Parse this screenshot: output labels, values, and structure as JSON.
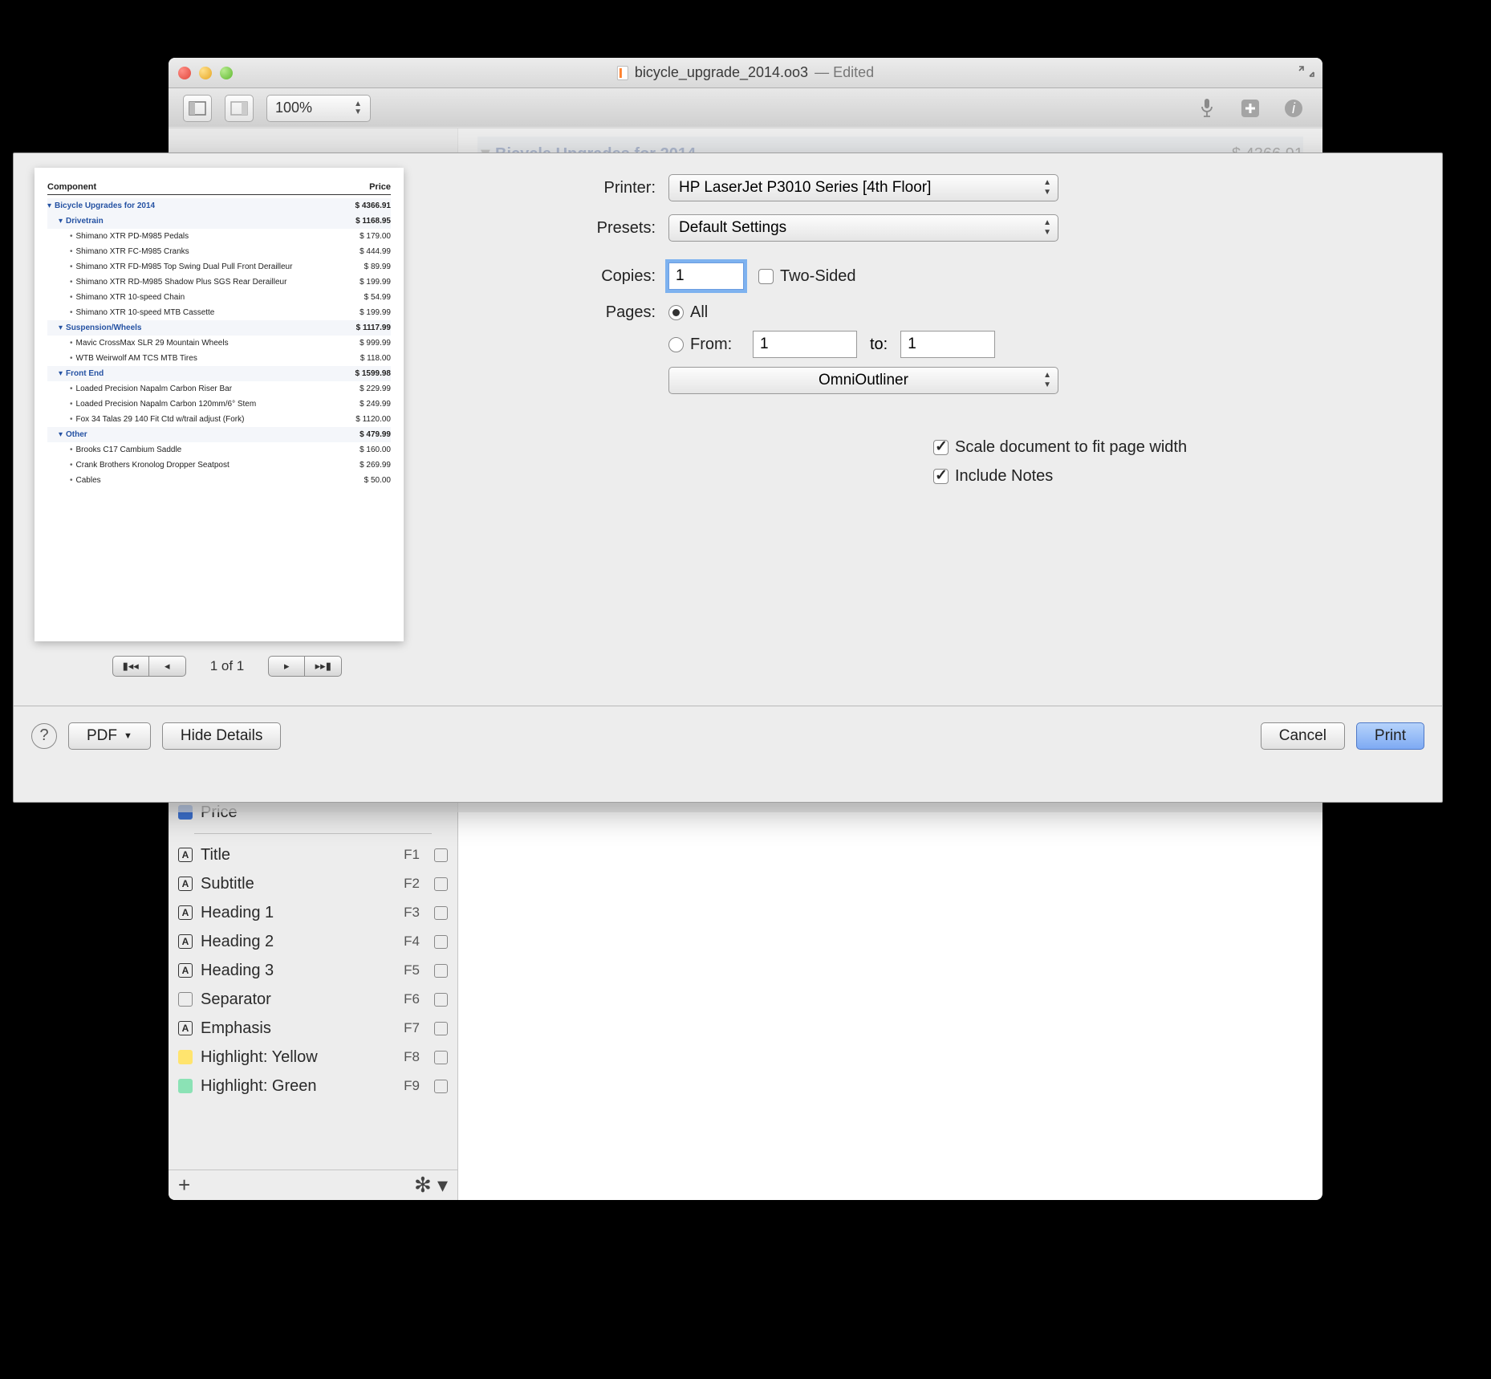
{
  "window": {
    "title": "bicycle_upgrade_2014.oo3",
    "status": "— Edited"
  },
  "toolbar": {
    "zoom": "100%"
  },
  "main": {
    "col1": "Component",
    "col2": "Price",
    "rows": [
      {
        "lbl": "Bicycle Upgrades for 2014",
        "price": "$ 4366.91",
        "lvl": 0,
        "tri": true,
        "hi": true
      },
      {
        "lbl": "Drivetrain",
        "price": "$ 1168.95",
        "lvl": 1,
        "tri": true,
        "hi": true
      },
      {
        "lbl": "Shimano XTR PD-M985 Pedals",
        "price": "$ 179.00",
        "lvl": 2
      },
      {
        "lbl": "Shimano XTR FC-M985 Cranks",
        "price": "$ 444.99",
        "lvl": 2
      },
      {
        "lbl": "Shimano XTR FD-M985 Top Swing Dual Pull Front Derailleur",
        "price": "$ 89.99",
        "lvl": 2
      },
      {
        "lbl": "Shimano XTR RD-M985 Shadow Plus SGS Rear Derailleur",
        "price": "$ 199.99",
        "lvl": 2
      },
      {
        "lbl": "Shimano XTR 10-speed Chain",
        "price": "$ 54.99",
        "lvl": 2
      },
      {
        "lbl": "Shimano XTR 10-speed MTB Cassette",
        "price": "$ 199.99",
        "lvl": 2
      },
      {
        "lbl": "Suspension/Wheels",
        "price": "$ 1117.99",
        "lvl": 1,
        "tri": true,
        "hi": true
      },
      {
        "lbl": "Mavic CrossMax SLR 29 Mountain Wheels",
        "price": "$ 999.99",
        "lvl": 2
      },
      {
        "lbl": "WTB Weirwolf AM TCS MTB Tires",
        "price": "$ 118.00",
        "lvl": 2
      },
      {
        "lbl": "Front End",
        "price": "$ 1599.98",
        "lvl": 1,
        "tri": true,
        "hi": true
      },
      {
        "lbl": "Loaded Precision Napalm Carbon Riser Bar",
        "price": "$ 229.99",
        "lvl": 2
      },
      {
        "lbl": "Loaded Precision Napalm Carbon 120mm/6° Stem",
        "price": "$ 249.99",
        "lvl": 2
      },
      {
        "lbl": "Fox 34 Talas 29 140 Fit Ctd w/trail adjust (Fork)",
        "price": "$ 1120.00",
        "lvl": 2
      },
      {
        "lbl": "Other",
        "price": "$ 479.99",
        "lvl": 1,
        "tri": true,
        "hi": true
      },
      {
        "lbl": "Brooks C17 Cambium Saddle",
        "price": "$ 160.00",
        "lvl": 2
      },
      {
        "lbl": "Crank Brothers Kronolog Dropper Seatpost",
        "price": "$ 269.99",
        "lvl": 2
      },
      {
        "lbl": "Cables",
        "price": "$ 50.00",
        "lvl": 2
      }
    ]
  },
  "sidebar": {
    "columns": [
      {
        "name": "Component"
      },
      {
        "name": "Price"
      }
    ],
    "styles": [
      {
        "name": "Title",
        "key": "F1"
      },
      {
        "name": "Subtitle",
        "key": "F2"
      },
      {
        "name": "Heading 1",
        "key": "F3"
      },
      {
        "name": "Heading 2",
        "key": "F4"
      },
      {
        "name": "Heading 3",
        "key": "F5"
      },
      {
        "name": "Separator",
        "key": "F6"
      },
      {
        "name": "Emphasis",
        "key": "F7"
      },
      {
        "name": "Highlight: Yellow",
        "key": "F8"
      },
      {
        "name": "Highlight: Green",
        "key": "F9"
      }
    ]
  },
  "print": {
    "printer_label": "Printer:",
    "printer_value": "HP LaserJet P3010 Series [4th Floor]",
    "presets_label": "Presets:",
    "presets_value": "Default Settings",
    "copies_label": "Copies:",
    "copies_value": "1",
    "two_sided": "Two-Sided",
    "pages_label": "Pages:",
    "all": "All",
    "from": "From:",
    "from_value": "1",
    "to": "to:",
    "to_value": "1",
    "app_select": "OmniOutliner",
    "scale": "Scale document to fit page width",
    "include": "Include Notes",
    "page_indicator": "1 of 1",
    "help": "?",
    "pdf": "PDF",
    "hide": "Hide Details",
    "cancel": "Cancel",
    "print": "Print"
  }
}
